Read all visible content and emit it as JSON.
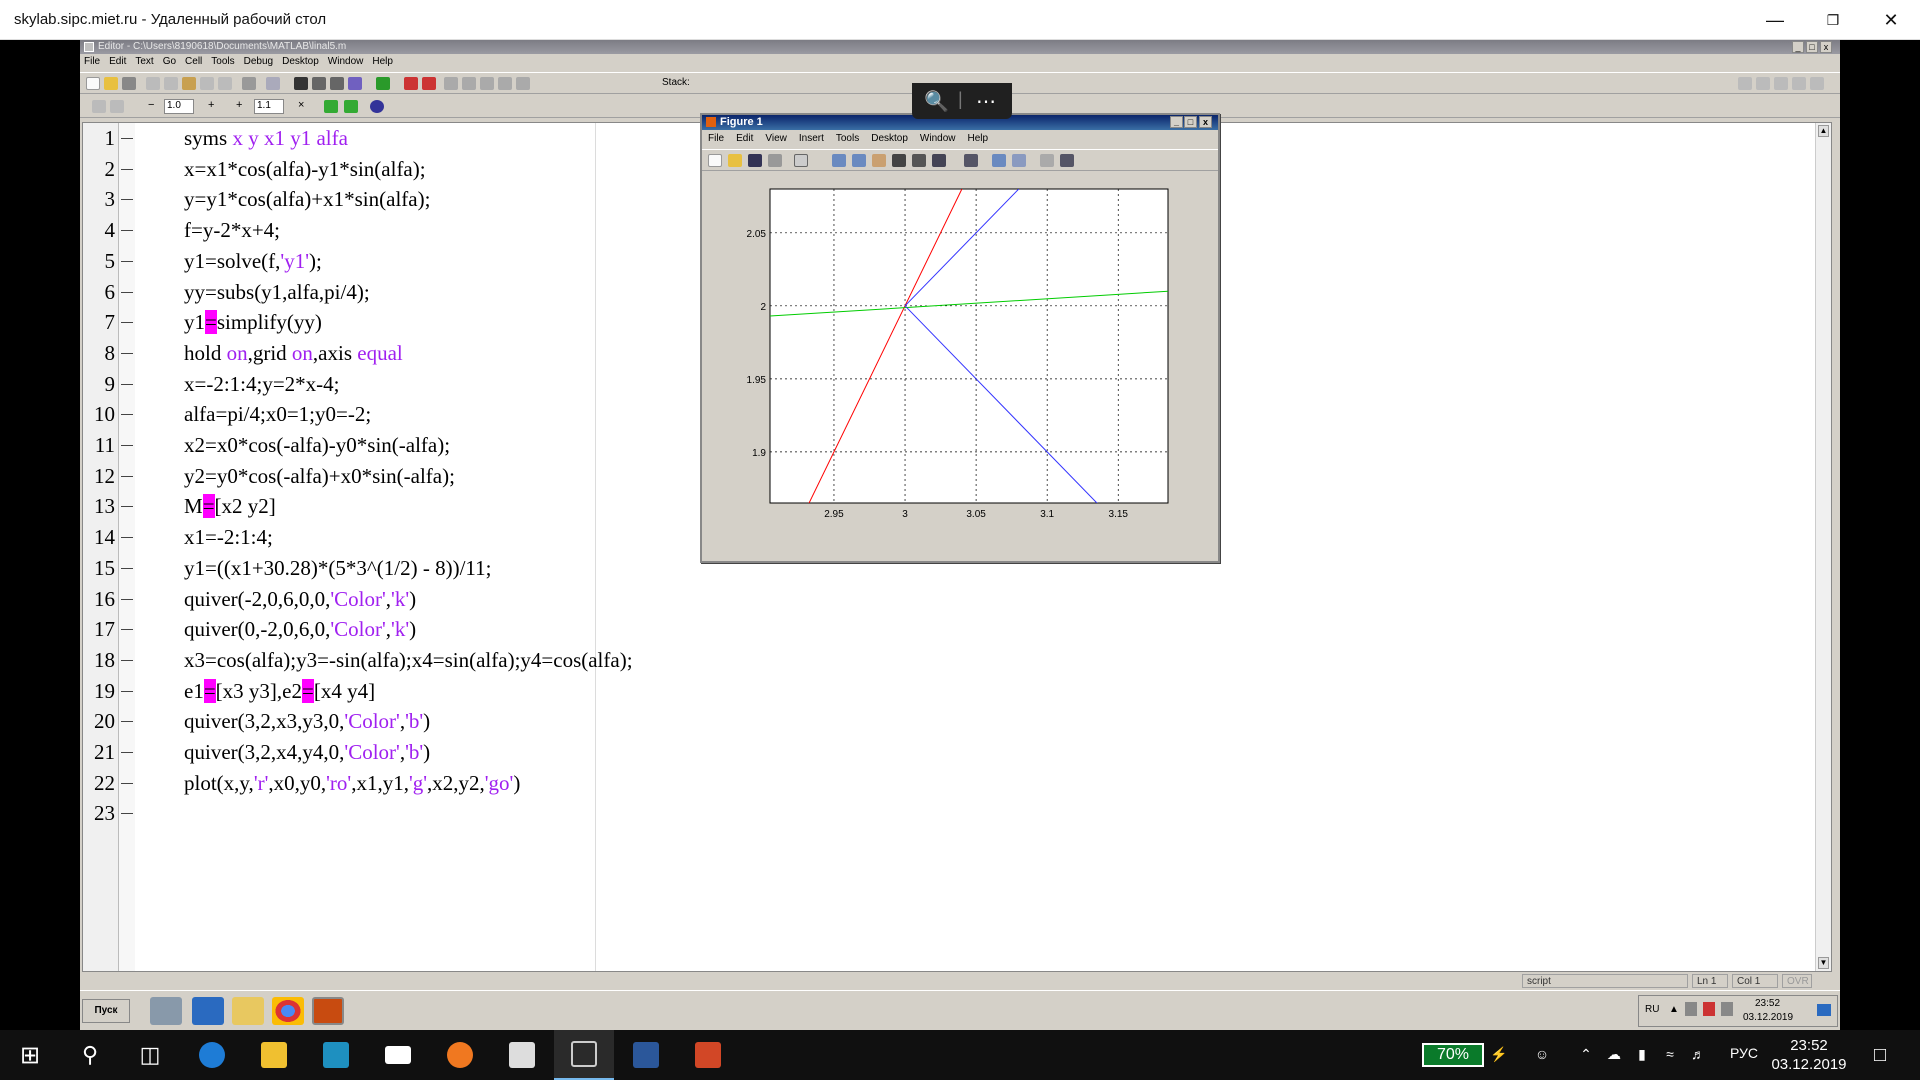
{
  "rdp": {
    "title": "skylab.sipc.miet.ru - Удаленный рабочий стол",
    "pill_zoom": "🔍",
    "pill_more": "⋯"
  },
  "editor": {
    "title": "Editor - C:\\Users\\8190618\\Documents\\MATLAB\\linal5.m",
    "menu": [
      "File",
      "Edit",
      "Text",
      "Go",
      "Cell",
      "Tools",
      "Debug",
      "Desktop",
      "Window",
      "Help"
    ],
    "stack_label": "Stack:",
    "cell_value1": "1.0",
    "cell_value2": "1.1",
    "status": {
      "mode": "script",
      "ln_label": "Ln",
      "ln": "1",
      "col_label": "Col",
      "col": "1",
      "ovr": "OVR"
    },
    "lines": [
      {
        "n": "1",
        "parts": [
          {
            "t": "syms "
          },
          {
            "t": "x y x1 y1 alfa",
            "c": "s"
          }
        ]
      },
      {
        "n": "2",
        "parts": [
          {
            "t": "x=x1*cos(alfa)-y1*sin(alfa);"
          }
        ]
      },
      {
        "n": "3",
        "parts": [
          {
            "t": "y=y1*cos(alfa)+x1*sin(alfa);"
          }
        ]
      },
      {
        "n": "4",
        "parts": [
          {
            "t": "f=y-2*x+4;"
          }
        ]
      },
      {
        "n": "5",
        "parts": [
          {
            "t": "y1=solve(f,"
          },
          {
            "t": "'y1'",
            "c": "s"
          },
          {
            "t": ");"
          }
        ]
      },
      {
        "n": "6",
        "parts": [
          {
            "t": "yy=subs(y1,alfa,pi/4);"
          }
        ]
      },
      {
        "n": "7",
        "parts": [
          {
            "t": "y1"
          },
          {
            "t": "=",
            "c": "hl"
          },
          {
            "t": "simplify(yy)"
          }
        ]
      },
      {
        "n": "8",
        "parts": [
          {
            "t": "hold "
          },
          {
            "t": "on",
            "c": "s"
          },
          {
            "t": ",grid "
          },
          {
            "t": "on",
            "c": "s"
          },
          {
            "t": ",axis "
          },
          {
            "t": "equal",
            "c": "s"
          }
        ]
      },
      {
        "n": "9",
        "parts": [
          {
            "t": "x=-2:1:4;y=2*x-4;"
          }
        ]
      },
      {
        "n": "10",
        "parts": [
          {
            "t": "alfa=pi/4;x0=1;y0=-2;"
          }
        ]
      },
      {
        "n": "11",
        "parts": [
          {
            "t": "x2=x0*cos(-alfa)-y0*sin(-alfa);"
          }
        ]
      },
      {
        "n": "12",
        "parts": [
          {
            "t": "y2=y0*cos(-alfa)+x0*sin(-alfa);"
          }
        ]
      },
      {
        "n": "13",
        "parts": [
          {
            "t": "M"
          },
          {
            "t": "=",
            "c": "hl"
          },
          {
            "t": "[x2 y2]"
          }
        ]
      },
      {
        "n": "14",
        "parts": [
          {
            "t": "x1=-2:1:4;"
          }
        ]
      },
      {
        "n": "15",
        "parts": [
          {
            "t": "y1=((x1+30.28)*(5*3^(1/2) - 8))/11;"
          }
        ]
      },
      {
        "n": "16",
        "parts": [
          {
            "t": "quiver(-2,0,6,0,0,"
          },
          {
            "t": "'Color'",
            "c": "s"
          },
          {
            "t": ","
          },
          {
            "t": "'k'",
            "c": "s"
          },
          {
            "t": ")"
          }
        ]
      },
      {
        "n": "17",
        "parts": [
          {
            "t": "quiver(0,-2,0,6,0,"
          },
          {
            "t": "'Color'",
            "c": "s"
          },
          {
            "t": ","
          },
          {
            "t": "'k'",
            "c": "s"
          },
          {
            "t": ")"
          }
        ]
      },
      {
        "n": "18",
        "parts": [
          {
            "t": "x3=cos(alfa);y3=-sin(alfa);x4=sin(alfa);y4=cos(alfa);"
          }
        ]
      },
      {
        "n": "19",
        "parts": [
          {
            "t": "e1"
          },
          {
            "t": "=",
            "c": "hl"
          },
          {
            "t": "[x3 y3],e2"
          },
          {
            "t": "=",
            "c": "hl"
          },
          {
            "t": "[x4 y4]"
          }
        ]
      },
      {
        "n": "20",
        "parts": [
          {
            "t": "quiver(3,2,x3,y3,0,"
          },
          {
            "t": "'Color'",
            "c": "s"
          },
          {
            "t": ","
          },
          {
            "t": "'b'",
            "c": "s"
          },
          {
            "t": ")"
          }
        ]
      },
      {
        "n": "21",
        "parts": [
          {
            "t": "quiver(3,2,x4,y4,0,"
          },
          {
            "t": "'Color'",
            "c": "s"
          },
          {
            "t": ","
          },
          {
            "t": "'b'",
            "c": "s"
          },
          {
            "t": ")"
          }
        ]
      },
      {
        "n": "22",
        "parts": [
          {
            "t": "plot(x,y,"
          },
          {
            "t": "'r'",
            "c": "s"
          },
          {
            "t": ",x0,y0,"
          },
          {
            "t": "'ro'",
            "c": "s"
          },
          {
            "t": ",x1,y1,"
          },
          {
            "t": "'g'",
            "c": "s"
          },
          {
            "t": ",x2,y2,"
          },
          {
            "t": "'go'",
            "c": "s"
          },
          {
            "t": ")"
          }
        ]
      },
      {
        "n": "23",
        "parts": [
          {
            "t": ""
          }
        ]
      }
    ]
  },
  "figure": {
    "title": "Figure 1",
    "menu": [
      "File",
      "Edit",
      "View",
      "Insert",
      "Tools",
      "Desktop",
      "Window",
      "Help"
    ]
  },
  "chart_data": {
    "type": "line",
    "xlim": [
      2.905,
      3.185
    ],
    "ylim": [
      1.865,
      2.08
    ],
    "x_ticks": [
      "2.95",
      "3",
      "3.05",
      "3.1",
      "3.15"
    ],
    "y_ticks": [
      "1.9",
      "1.95",
      "2",
      "2.05"
    ],
    "x_tick_values": [
      2.95,
      3,
      3.05,
      3.1,
      3.15
    ],
    "y_tick_values": [
      1.9,
      1.95,
      2,
      2.05
    ],
    "grid": true,
    "series": [
      {
        "color": "#ff0000",
        "points": [
          [
            2.93,
            1.86
          ],
          [
            3.04,
            2.08
          ]
        ]
      },
      {
        "color": "#00cc00",
        "points": [
          [
            2.905,
            1.993
          ],
          [
            3.185,
            2.01
          ]
        ]
      },
      {
        "color": "#3333ff",
        "points": [
          [
            3,
            2
          ],
          [
            3.08,
            2.08
          ]
        ]
      },
      {
        "color": "#3333ff",
        "points": [
          [
            3,
            2
          ],
          [
            3.14,
            1.86
          ]
        ]
      }
    ]
  },
  "xp_taskbar": {
    "start_label": "Пуск",
    "tray_lang": "RU",
    "tray_time": "23:52",
    "tray_date": "03.12.2019"
  },
  "win_taskbar": {
    "battery": "70%",
    "lang": "РУС",
    "time": "23:52",
    "date": "03.12.2019"
  }
}
